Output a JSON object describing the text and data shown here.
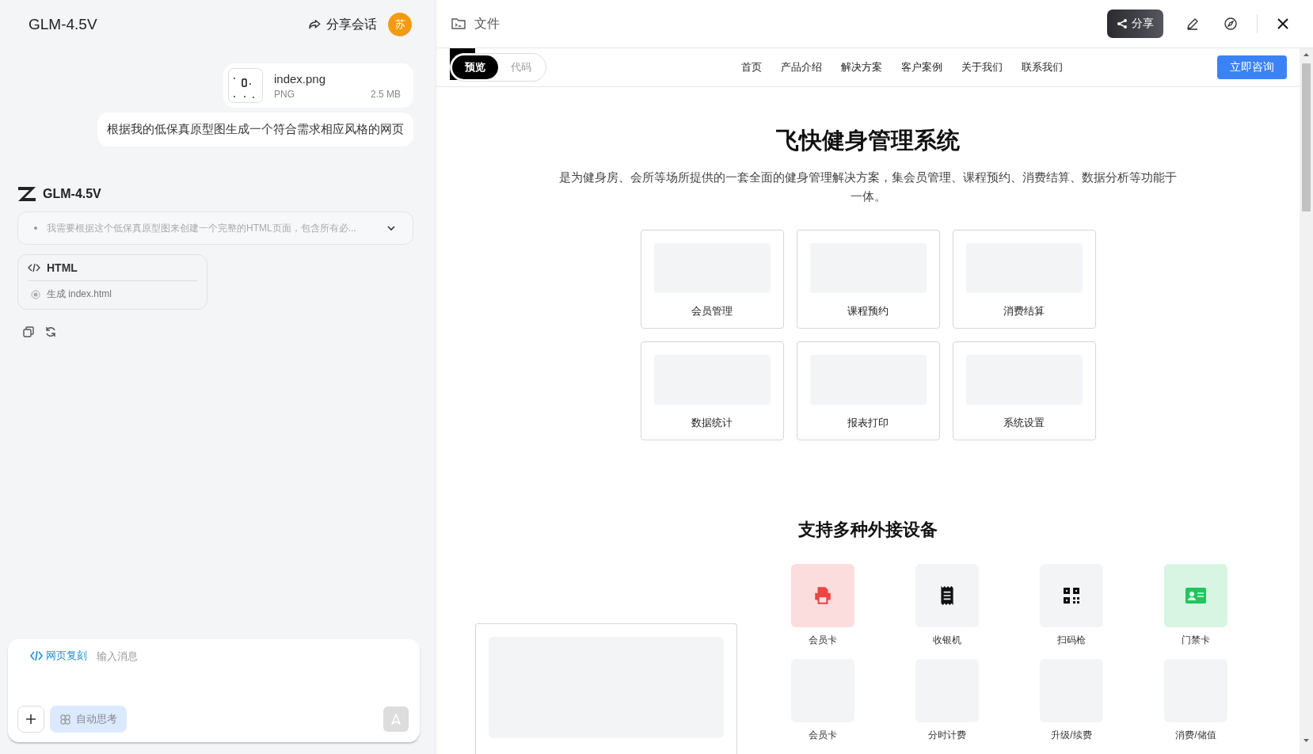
{
  "chat": {
    "title": "GLM-4.5V",
    "share_label": "分享会话",
    "avatar": "苏",
    "attachment": {
      "name": "index.png",
      "type": "PNG",
      "size": "2.5 MB"
    },
    "user_message": "根据我的低保真原型图生成一个符合需求相应风格的网页",
    "assistant": {
      "name": "GLM-4.5V",
      "thinking": "我需要根据这个低保真原型图来创建一个完整的HTML页面，包含所有必...",
      "expanded": false,
      "artifact": {
        "title": "HTML",
        "step": "生成 index.html"
      }
    },
    "composer": {
      "tag": "网页复刻",
      "placeholder": "输入消息",
      "auto_think": "自动思考"
    }
  },
  "viewer": {
    "title": "文件",
    "share_label": "分享",
    "tabs": [
      {
        "label": "预览",
        "selected": true
      },
      {
        "label": "代码",
        "selected": false
      }
    ],
    "site": {
      "nav": [
        "首页",
        "产品介绍",
        "解决方案",
        "客户案例",
        "关于我们",
        "联系我们"
      ],
      "cta": "立即咨询",
      "hero_title": "飞快健身管理系统",
      "hero_text": "是为健身房、会所等场所提供的一套全面的健身管理解决方案，集会员管理、课程预约、消费结算、数据分析等功能于一体。",
      "features": [
        "会员管理",
        "课程预约",
        "消费结算",
        "数据统计",
        "报表打印",
        "系统设置"
      ],
      "devices_title": "支持多种外接设备",
      "devices": [
        {
          "label": "会员卡",
          "kind": "printer",
          "color": "#ef4444"
        },
        {
          "label": "收银机",
          "kind": "receipt",
          "color": "#111111"
        },
        {
          "label": "扫码枪",
          "kind": "qrcode",
          "color": "#111111"
        },
        {
          "label": "门禁卡",
          "kind": "idcard",
          "color": "#22c55e"
        },
        {
          "label": "会员卡",
          "kind": "blank"
        },
        {
          "label": "分时计费",
          "kind": "blank"
        },
        {
          "label": "升级/续费",
          "kind": "blank"
        },
        {
          "label": "消费/储值",
          "kind": "blank"
        }
      ]
    }
  }
}
